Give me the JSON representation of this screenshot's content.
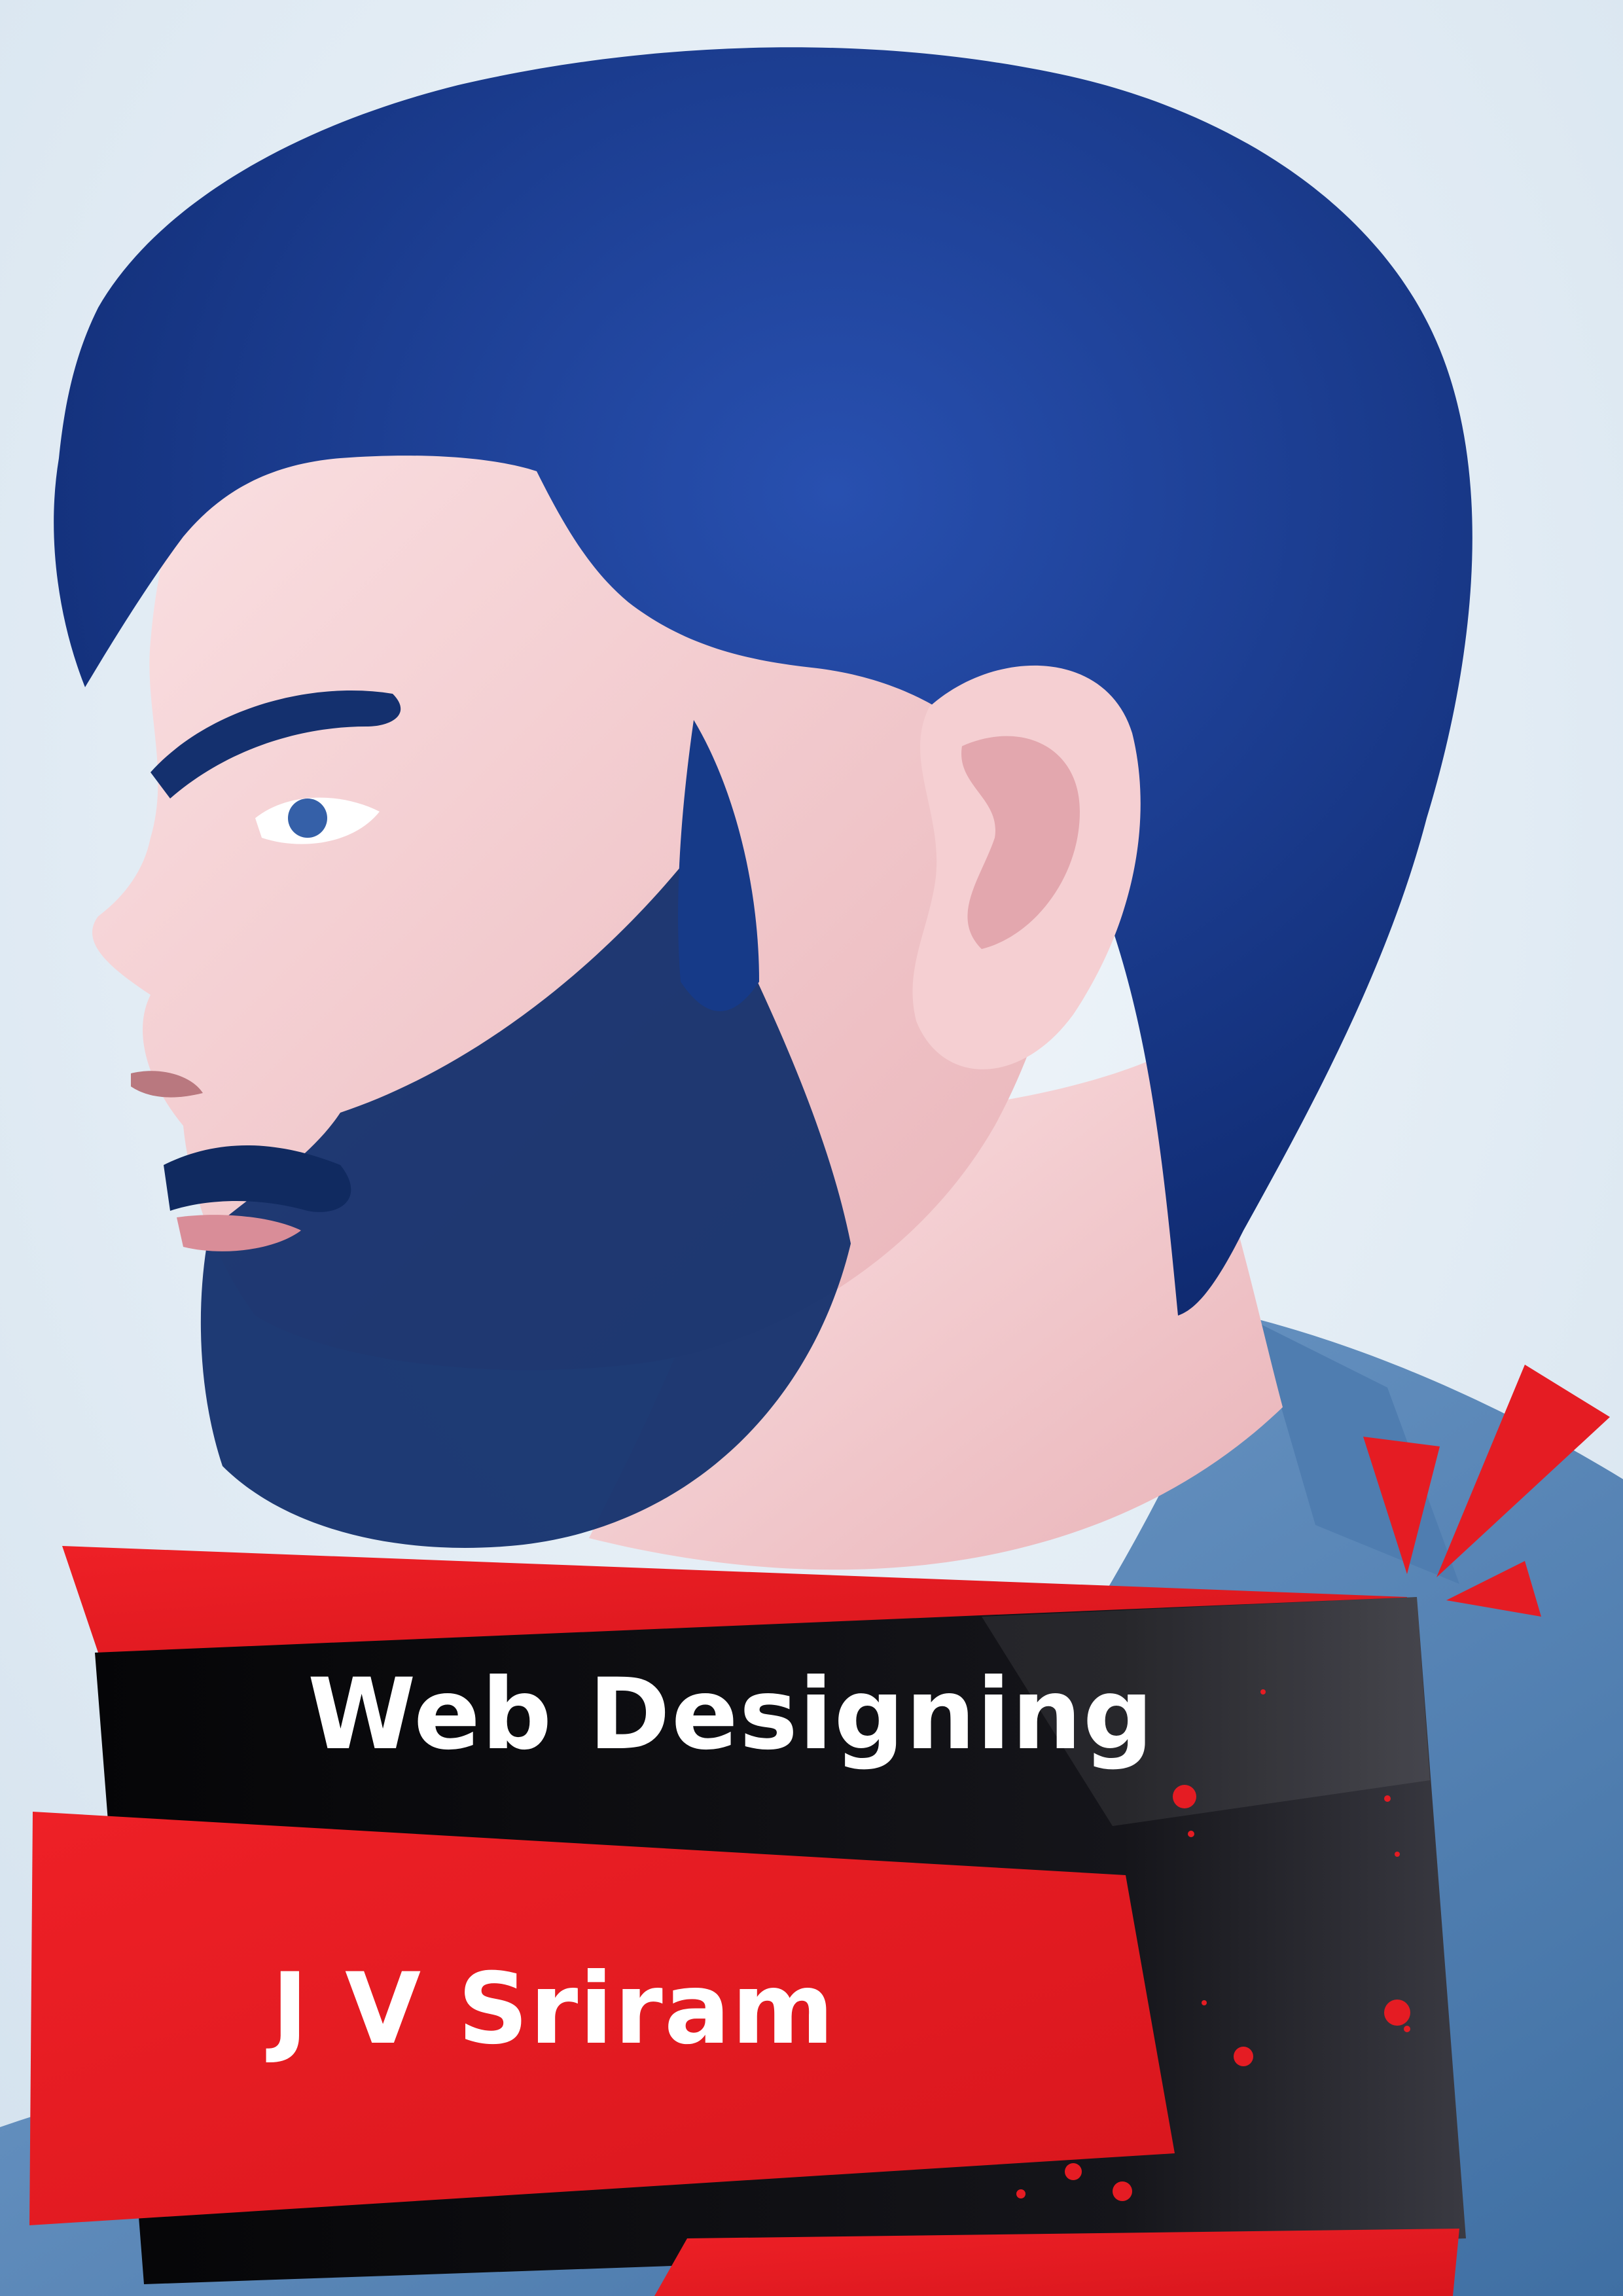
{
  "banner": {
    "title": "Web Designing",
    "name": "J V Sriram"
  },
  "colors": {
    "accent_red": "#e51c23",
    "panel_black": "#0d0d0f",
    "background": "#e4eef5",
    "hair_blue": "#1a3a8c",
    "skin": "#f3c8c8",
    "shirt": "#5a86b8"
  },
  "photo": {
    "subject": "man-profile-portrait"
  }
}
